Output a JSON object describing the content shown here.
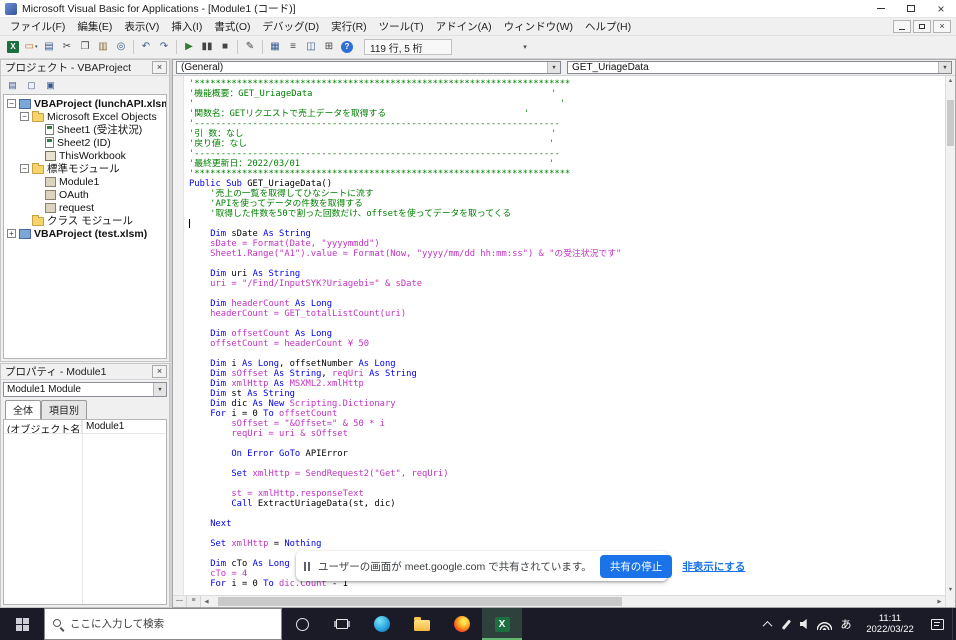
{
  "titlebar": {
    "title": "Microsoft Visual Basic for Applications - [Module1 (コード)]"
  },
  "menubar": {
    "items": [
      "ファイル(F)",
      "編集(E)",
      "表示(V)",
      "挿入(I)",
      "書式(O)",
      "デバッグ(D)",
      "実行(R)",
      "ツール(T)",
      "アドイン(A)",
      "ウィンドウ(W)",
      "ヘルプ(H)"
    ]
  },
  "toolbar": {
    "position_indicator": "119 行, 5 桁",
    "icons": [
      {
        "name": "view-excel-icon",
        "kind": "excel",
        "glyph": "X"
      },
      {
        "name": "insert-userform-icon",
        "glyph": "▭",
        "color": "#c06a28",
        "dropdown": true
      },
      {
        "name": "save-icon",
        "glyph": "▤",
        "color": "#35598f"
      },
      {
        "name": "cut-icon",
        "glyph": "✂",
        "color": "#444444"
      },
      {
        "name": "copy-icon",
        "glyph": "❐",
        "color": "#444444"
      },
      {
        "name": "paste-icon",
        "glyph": "▥",
        "color": "#8a6d3b"
      },
      {
        "name": "find-icon",
        "glyph": "◎",
        "color": "#35598f"
      },
      {
        "sep": true
      },
      {
        "name": "undo-icon",
        "glyph": "↶",
        "color": "#35598f"
      },
      {
        "name": "redo-icon",
        "glyph": "↷",
        "color": "#35598f"
      },
      {
        "sep": true
      },
      {
        "name": "run-icon",
        "glyph": "▶",
        "color": "#2d7d2d"
      },
      {
        "name": "break-icon",
        "glyph": "▮▮",
        "color": "#444444"
      },
      {
        "name": "reset-icon",
        "glyph": "■",
        "color": "#444444"
      },
      {
        "sep": true
      },
      {
        "name": "design-mode-icon",
        "glyph": "✎",
        "color": "#444444"
      },
      {
        "sep": true
      },
      {
        "name": "project-explorer-icon",
        "glyph": "▦",
        "color": "#35598f"
      },
      {
        "name": "properties-window-icon",
        "glyph": "≡",
        "color": "#444444"
      },
      {
        "name": "object-browser-icon",
        "glyph": "◫",
        "color": "#35598f"
      },
      {
        "name": "toolbox-icon",
        "glyph": "⊞",
        "color": "#444444"
      },
      {
        "name": "help-icon",
        "kind": "help",
        "glyph": "?"
      }
    ]
  },
  "project_panel": {
    "title": "プロジェクト - VBAProject",
    "toolbar_icons": [
      {
        "name": "view-code-icon",
        "glyph": "▤"
      },
      {
        "name": "view-object-icon",
        "glyph": "▢"
      },
      {
        "name": "toggle-folders-icon",
        "glyph": "▣"
      }
    ],
    "tree": [
      {
        "label": "VBAProject (lunchAPI.xlsm)",
        "level": 0,
        "expander": "-",
        "icon": "project",
        "bold": true
      },
      {
        "label": "Microsoft Excel Objects",
        "level": 1,
        "expander": "-",
        "icon": "folder"
      },
      {
        "label": "Sheet1 (受注状況)",
        "level": 2,
        "icon": "sheet"
      },
      {
        "label": "Sheet2 (ID)",
        "level": 2,
        "icon": "sheet"
      },
      {
        "label": "ThisWorkbook",
        "level": 2,
        "icon": "workbook"
      },
      {
        "label": "標準モジュール",
        "level": 1,
        "expander": "-",
        "icon": "folder"
      },
      {
        "label": "Module1",
        "level": 2,
        "icon": "module"
      },
      {
        "label": "OAuth",
        "level": 2,
        "icon": "module"
      },
      {
        "label": "request",
        "level": 2,
        "icon": "module"
      },
      {
        "label": "クラス モジュール",
        "level": 1,
        "icon": "folder"
      },
      {
        "label": "VBAProject (test.xlsm)",
        "level": 0,
        "expander": "+",
        "icon": "project",
        "bold": true
      }
    ]
  },
  "properties_panel": {
    "title": "プロパティ - Module1",
    "object_selector": "Module1 Module",
    "tabs": [
      "全体",
      "項目別"
    ],
    "rows": [
      {
        "name": "(オブジェクト名)",
        "value": "Module1"
      }
    ]
  },
  "code_window": {
    "object_dropdown": "(General)",
    "procedure_dropdown": "GET_UriageData",
    "caret_line": 14,
    "lines": [
      [
        [
          "c",
          "'***********************************************************************"
        ]
      ],
      [
        [
          "c",
          "'機能概要：GET_UriageData                                             '"
        ]
      ],
      [
        [
          "c",
          "'                                                                     '"
        ]
      ],
      [
        [
          "c",
          "'関数名：GETリクエストで売上データを取得する                          '"
        ]
      ],
      [
        [
          "c",
          "'---------------------------------------------------------------------"
        ]
      ],
      [
        [
          "c",
          "'引 数：なし                                                          '"
        ]
      ],
      [
        [
          "c",
          "'戻り値：なし                                                         '"
        ]
      ],
      [
        [
          "c",
          "'---------------------------------------------------------------------"
        ]
      ],
      [
        [
          "c",
          "'最終更新日：2022/03/01                                               '"
        ]
      ],
      [
        [
          "c",
          "'***********************************************************************"
        ]
      ],
      [
        [
          "k",
          "Public Sub "
        ],
        [
          "t",
          "GET_UriageData()"
        ]
      ],
      [
        [
          "c",
          "    '売上の一覧を取得してひなシートに流す"
        ]
      ],
      [
        [
          "c",
          "    'APIを使ってデータの件数を取得する"
        ]
      ],
      [
        [
          "c",
          "    '取得した件数を50で割った回数だけ、offsetを使ってデータを取ってくる"
        ]
      ],
      [],
      [
        [
          "t",
          "    "
        ],
        [
          "k",
          "Dim"
        ],
        [
          "t",
          " sDate "
        ],
        [
          "k",
          "As String"
        ]
      ],
      [
        [
          "m",
          "    sDate = Format(Date, \"yyyymmdd\")"
        ]
      ],
      [
        [
          "m",
          "    Sheet1.Range(\"A1\").value = Format(Now, \"yyyy/mm/dd hh:mm:ss\") & \"の受注状況です\""
        ]
      ],
      [],
      [
        [
          "t",
          "    "
        ],
        [
          "k",
          "Dim"
        ],
        [
          "t",
          " uri "
        ],
        [
          "k",
          "As String"
        ]
      ],
      [
        [
          "m",
          "    uri = \"/Find/InputSYK?Uriagebi=\" & sDate"
        ]
      ],
      [],
      [
        [
          "t",
          "    "
        ],
        [
          "k",
          "Dim"
        ],
        [
          "m",
          " headerCount "
        ],
        [
          "k",
          "As Long"
        ]
      ],
      [
        [
          "m",
          "    headerCount = GET_totalListCount(uri)"
        ]
      ],
      [],
      [
        [
          "t",
          "    "
        ],
        [
          "k",
          "Dim"
        ],
        [
          "m",
          " offsetCount "
        ],
        [
          "k",
          "As Long"
        ]
      ],
      [
        [
          "m",
          "    offsetCount = headerCount ¥ 50"
        ]
      ],
      [],
      [
        [
          "t",
          "    "
        ],
        [
          "k",
          "Dim"
        ],
        [
          "t",
          " i "
        ],
        [
          "k",
          "As Long"
        ],
        [
          "t",
          ", offsetNumber "
        ],
        [
          "k",
          "As Long"
        ]
      ],
      [
        [
          "t",
          "    "
        ],
        [
          "k",
          "Dim"
        ],
        [
          "m",
          " sOffset "
        ],
        [
          "k",
          "As String"
        ],
        [
          "t",
          ", "
        ],
        [
          "m",
          "reqUri "
        ],
        [
          "k",
          "As String"
        ]
      ],
      [
        [
          "t",
          "    "
        ],
        [
          "k",
          "Dim"
        ],
        [
          "m",
          " xmlHttp "
        ],
        [
          "k",
          "As"
        ],
        [
          "m",
          " MSXML2.xmlHttp"
        ]
      ],
      [
        [
          "t",
          "    "
        ],
        [
          "k",
          "Dim"
        ],
        [
          "t",
          " st "
        ],
        [
          "k",
          "As String"
        ]
      ],
      [
        [
          "t",
          "    "
        ],
        [
          "k",
          "Dim"
        ],
        [
          "t",
          " dic "
        ],
        [
          "k",
          "As New"
        ],
        [
          "m",
          " Scripting.Dictionary"
        ]
      ],
      [
        [
          "t",
          "    "
        ],
        [
          "k",
          "For"
        ],
        [
          "t",
          " i = 0 "
        ],
        [
          "k",
          "To"
        ],
        [
          "m",
          " offsetCount"
        ]
      ],
      [
        [
          "m",
          "        sOffset = \"&Offset=\" & 50 * i"
        ]
      ],
      [
        [
          "m",
          "        reqUri = uri & sOffset"
        ]
      ],
      [],
      [
        [
          "t",
          "        "
        ],
        [
          "k",
          "On Error GoTo"
        ],
        [
          "t",
          " APIError"
        ]
      ],
      [],
      [
        [
          "t",
          "        "
        ],
        [
          "k",
          "Set"
        ],
        [
          "m",
          " xmlHttp = SendRequest2(\"Get\", reqUri)"
        ]
      ],
      [],
      [
        [
          "m",
          "        st = xmlHttp.responseText"
        ]
      ],
      [
        [
          "t",
          "        "
        ],
        [
          "k",
          "Call"
        ],
        [
          "t",
          " ExtractUriageData(st, dic)"
        ]
      ],
      [],
      [
        [
          "t",
          "    "
        ],
        [
          "k",
          "Next"
        ]
      ],
      [],
      [
        [
          "t",
          "    "
        ],
        [
          "k",
          "Set"
        ],
        [
          "m",
          " xmlHttp "
        ],
        [
          "t",
          "= "
        ],
        [
          "k",
          "Nothing"
        ]
      ],
      [],
      [
        [
          "t",
          "    "
        ],
        [
          "k",
          "Dim"
        ],
        [
          "t",
          " cTo "
        ],
        [
          "k",
          "As Long"
        ]
      ],
      [
        [
          "m",
          "    cTo = 4"
        ]
      ],
      [
        [
          "t",
          "    "
        ],
        [
          "k",
          "For"
        ],
        [
          "t",
          " i = 0 "
        ],
        [
          "k",
          "To"
        ],
        [
          "m",
          " dic.Count"
        ],
        [
          "t",
          " - 1"
        ]
      ]
    ]
  },
  "share_notification": {
    "message": "ユーザーの画面が meet.google.com で共有されています。",
    "stop_button": "共有の停止",
    "hide_button": "非表示にする",
    "accent_color": "#1a73e8"
  },
  "taskbar": {
    "search_placeholder": "ここに入力して検索",
    "apps": [
      {
        "name": "cortana-button"
      },
      {
        "name": "task-view-button"
      },
      {
        "name": "edge-icon"
      },
      {
        "name": "file-explorer-icon"
      },
      {
        "name": "firefox-icon"
      },
      {
        "name": "excel-icon",
        "active": true
      }
    ],
    "tray": [
      "tray-chevron-icon",
      "tray-pen-icon",
      "tray-speaker-icon",
      "tray-network-icon"
    ],
    "ime_indicator": "あ",
    "clock": {
      "time": "11:11",
      "date": "2022/03/22"
    }
  },
  "colors": {
    "comment": "#008000",
    "keyword": "#0000ee",
    "highlight": "#c233c2",
    "notification_accent": "#1a73e8",
    "excel_green": "#1d6f42"
  }
}
